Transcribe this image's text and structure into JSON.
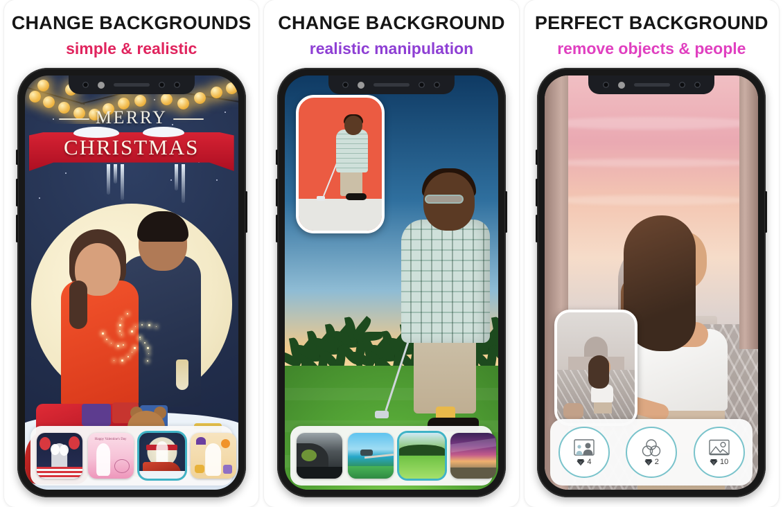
{
  "page": {
    "background": "#ffffff",
    "accent_teal": "#3fb3c6",
    "card_count": 3
  },
  "cards": [
    {
      "id": "change-backgrounds",
      "title": "CHANGE BACKGROUNDS",
      "subtitle": "simple & realistic",
      "subtitle_color": "#e0245e",
      "screen": {
        "type": "christmas-template",
        "headline_script": "MERRY",
        "banner_text": "CHRISTMAS"
      },
      "dock": {
        "type": "thumbnail-strip",
        "thumbnails": [
          {
            "name": "patriotic-template",
            "label": "",
            "selected": false
          },
          {
            "name": "valentines-template",
            "label": "Happy Valentine's Day",
            "selected": false
          },
          {
            "name": "christmas-template",
            "label": "CHRISTMAS",
            "selected": true
          },
          {
            "name": "halloween-template",
            "label": "",
            "selected": false
          }
        ]
      }
    },
    {
      "id": "change-background",
      "title": "CHANGE BACKGROUND",
      "subtitle": "realistic manipulation",
      "subtitle_color": "#8e3fd4",
      "screen": {
        "type": "golf-composite",
        "inset_label": "original-photo-preview"
      },
      "dock": {
        "type": "thumbnail-strip",
        "thumbnails": [
          {
            "name": "cave-background",
            "label": "",
            "selected": false
          },
          {
            "name": "beach-pier-background",
            "label": "",
            "selected": false
          },
          {
            "name": "golf-course-background",
            "label": "",
            "selected": true
          },
          {
            "name": "purple-sunset-background",
            "label": "",
            "selected": false
          }
        ]
      }
    },
    {
      "id": "perfect-background",
      "title": "PERFECT BACKGROUND",
      "subtitle": "remove objects & people",
      "subtitle_color": "#e040c0",
      "screen": {
        "type": "vatican-composite",
        "inset_label": "original-photo-preview"
      },
      "dock": {
        "type": "tool-buttons",
        "tools": [
          {
            "name": "replace-background-tool",
            "icon": "photo-person-icon",
            "cost": "4"
          },
          {
            "name": "color-filter-tool",
            "icon": "three-circles-icon",
            "cost": "2"
          },
          {
            "name": "image-retouch-tool",
            "icon": "landscape-image-icon",
            "cost": "10"
          }
        ],
        "currency_icon": "gem-icon"
      }
    }
  ]
}
